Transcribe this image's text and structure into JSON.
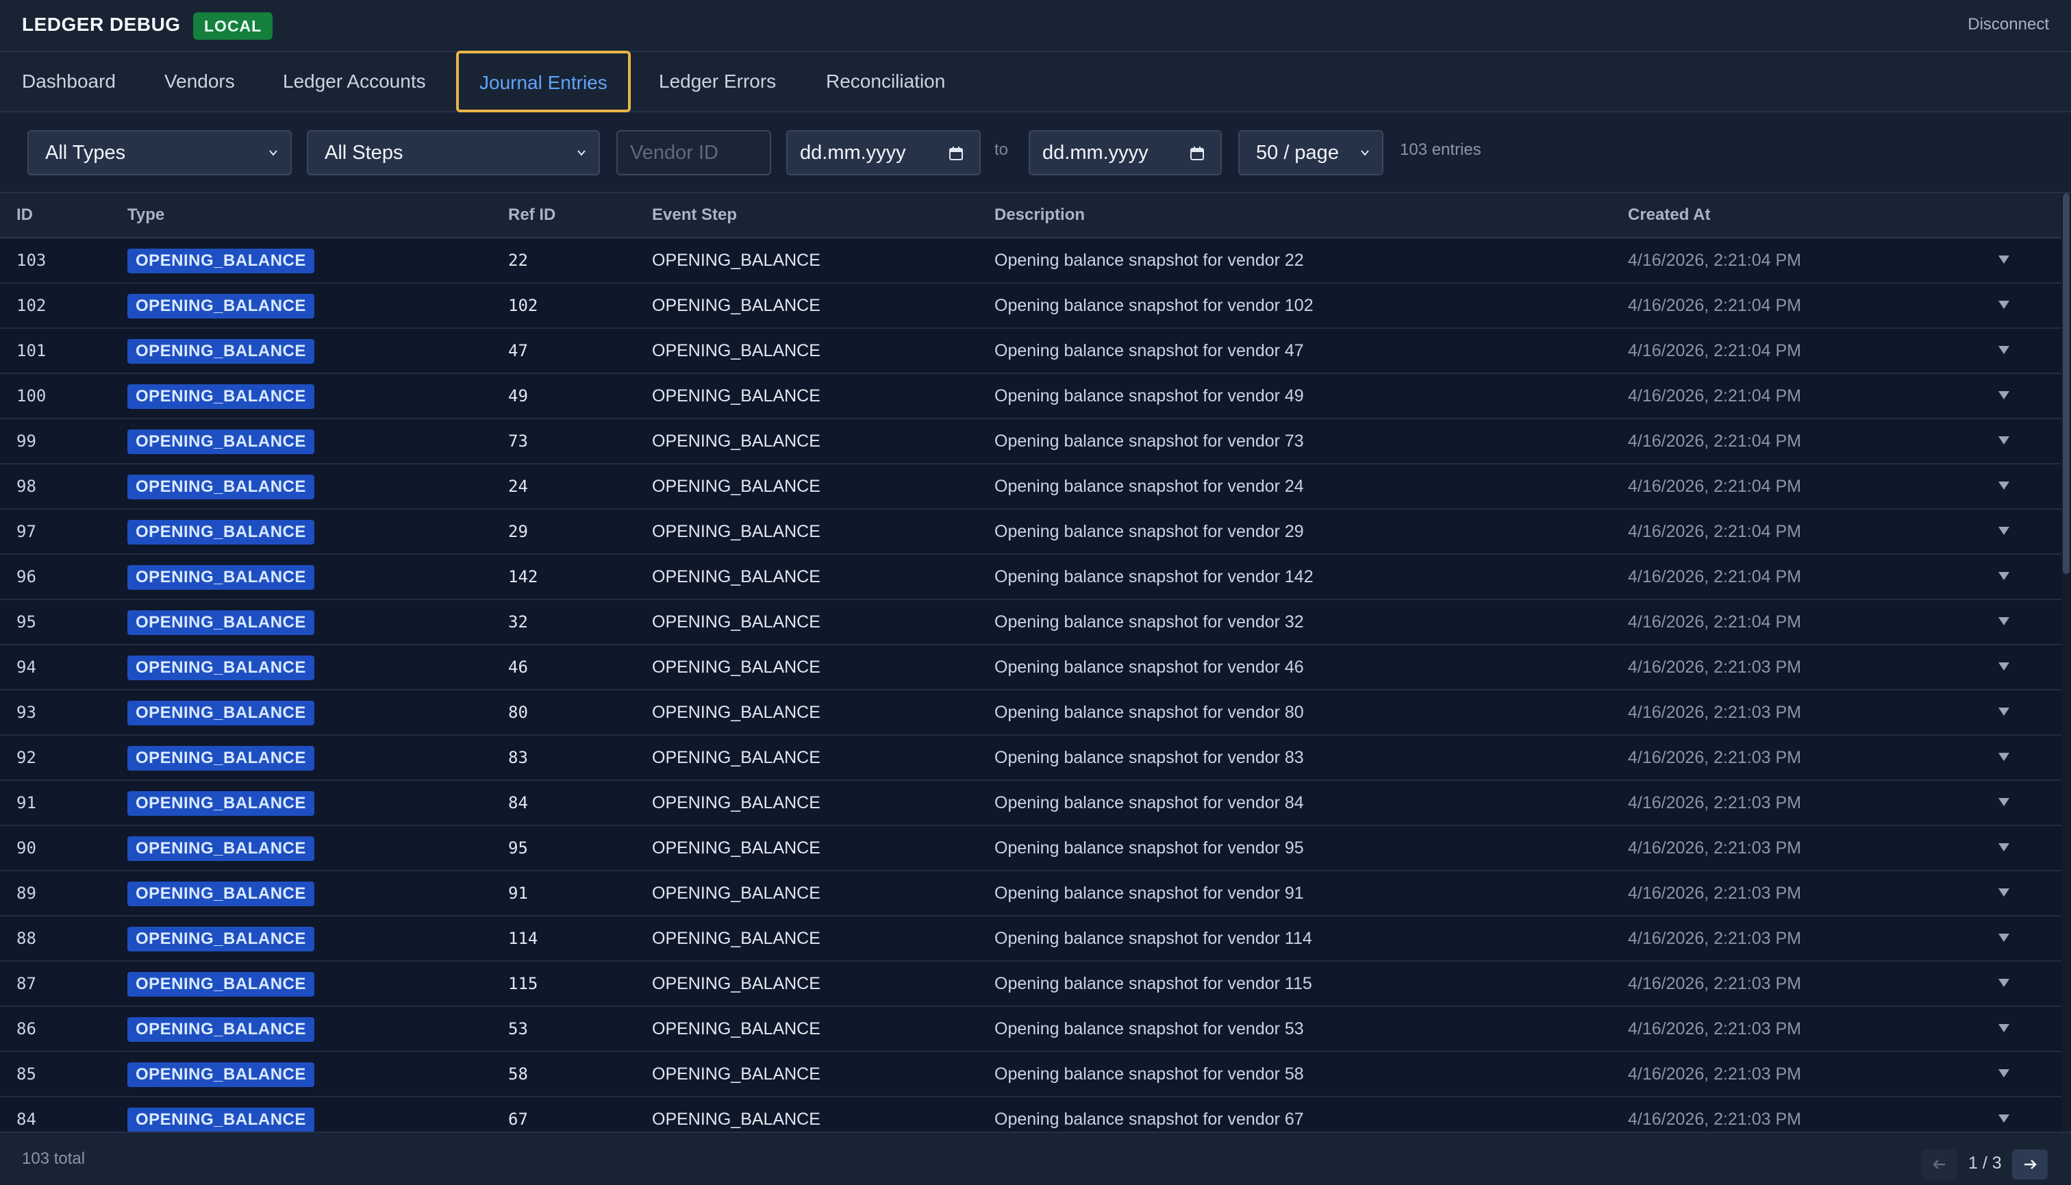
{
  "header": {
    "title": "LEDGER DEBUG",
    "env_badge": "LOCAL",
    "disconnect_label": "Disconnect"
  },
  "tabs": [
    {
      "label": "Dashboard"
    },
    {
      "label": "Vendors"
    },
    {
      "label": "Ledger Accounts"
    },
    {
      "label": "Journal Entries",
      "active": true
    },
    {
      "label": "Ledger Errors"
    },
    {
      "label": "Reconciliation"
    }
  ],
  "filters": {
    "type_select": "All Types",
    "step_select": "All Steps",
    "vendor_placeholder": "Vendor ID",
    "date_from": "dd.mm.yyyy",
    "to_label": "to",
    "date_to": "dd.mm.yyyy",
    "page_size": "50 / page",
    "entries_count": "103 entries"
  },
  "table": {
    "columns": [
      "ID",
      "Type",
      "Ref ID",
      "Event Step",
      "Description",
      "Created At"
    ],
    "rows": [
      {
        "id": "103",
        "type": "OPENING_BALANCE",
        "ref": "22",
        "step": "OPENING_BALANCE",
        "desc": "Opening balance snapshot for vendor 22",
        "created": "4/16/2026, 2:21:04 PM"
      },
      {
        "id": "102",
        "type": "OPENING_BALANCE",
        "ref": "102",
        "step": "OPENING_BALANCE",
        "desc": "Opening balance snapshot for vendor 102",
        "created": "4/16/2026, 2:21:04 PM"
      },
      {
        "id": "101",
        "type": "OPENING_BALANCE",
        "ref": "47",
        "step": "OPENING_BALANCE",
        "desc": "Opening balance snapshot for vendor 47",
        "created": "4/16/2026, 2:21:04 PM"
      },
      {
        "id": "100",
        "type": "OPENING_BALANCE",
        "ref": "49",
        "step": "OPENING_BALANCE",
        "desc": "Opening balance snapshot for vendor 49",
        "created": "4/16/2026, 2:21:04 PM"
      },
      {
        "id": "99",
        "type": "OPENING_BALANCE",
        "ref": "73",
        "step": "OPENING_BALANCE",
        "desc": "Opening balance snapshot for vendor 73",
        "created": "4/16/2026, 2:21:04 PM"
      },
      {
        "id": "98",
        "type": "OPENING_BALANCE",
        "ref": "24",
        "step": "OPENING_BALANCE",
        "desc": "Opening balance snapshot for vendor 24",
        "created": "4/16/2026, 2:21:04 PM"
      },
      {
        "id": "97",
        "type": "OPENING_BALANCE",
        "ref": "29",
        "step": "OPENING_BALANCE",
        "desc": "Opening balance snapshot for vendor 29",
        "created": "4/16/2026, 2:21:04 PM"
      },
      {
        "id": "96",
        "type": "OPENING_BALANCE",
        "ref": "142",
        "step": "OPENING_BALANCE",
        "desc": "Opening balance snapshot for vendor 142",
        "created": "4/16/2026, 2:21:04 PM"
      },
      {
        "id": "95",
        "type": "OPENING_BALANCE",
        "ref": "32",
        "step": "OPENING_BALANCE",
        "desc": "Opening balance snapshot for vendor 32",
        "created": "4/16/2026, 2:21:04 PM"
      },
      {
        "id": "94",
        "type": "OPENING_BALANCE",
        "ref": "46",
        "step": "OPENING_BALANCE",
        "desc": "Opening balance snapshot for vendor 46",
        "created": "4/16/2026, 2:21:03 PM"
      },
      {
        "id": "93",
        "type": "OPENING_BALANCE",
        "ref": "80",
        "step": "OPENING_BALANCE",
        "desc": "Opening balance snapshot for vendor 80",
        "created": "4/16/2026, 2:21:03 PM"
      },
      {
        "id": "92",
        "type": "OPENING_BALANCE",
        "ref": "83",
        "step": "OPENING_BALANCE",
        "desc": "Opening balance snapshot for vendor 83",
        "created": "4/16/2026, 2:21:03 PM"
      },
      {
        "id": "91",
        "type": "OPENING_BALANCE",
        "ref": "84",
        "step": "OPENING_BALANCE",
        "desc": "Opening balance snapshot for vendor 84",
        "created": "4/16/2026, 2:21:03 PM"
      },
      {
        "id": "90",
        "type": "OPENING_BALANCE",
        "ref": "95",
        "step": "OPENING_BALANCE",
        "desc": "Opening balance snapshot for vendor 95",
        "created": "4/16/2026, 2:21:03 PM"
      },
      {
        "id": "89",
        "type": "OPENING_BALANCE",
        "ref": "91",
        "step": "OPENING_BALANCE",
        "desc": "Opening balance snapshot for vendor 91",
        "created": "4/16/2026, 2:21:03 PM"
      },
      {
        "id": "88",
        "type": "OPENING_BALANCE",
        "ref": "114",
        "step": "OPENING_BALANCE",
        "desc": "Opening balance snapshot for vendor 114",
        "created": "4/16/2026, 2:21:03 PM"
      },
      {
        "id": "87",
        "type": "OPENING_BALANCE",
        "ref": "115",
        "step": "OPENING_BALANCE",
        "desc": "Opening balance snapshot for vendor 115",
        "created": "4/16/2026, 2:21:03 PM"
      },
      {
        "id": "86",
        "type": "OPENING_BALANCE",
        "ref": "53",
        "step": "OPENING_BALANCE",
        "desc": "Opening balance snapshot for vendor 53",
        "created": "4/16/2026, 2:21:03 PM"
      },
      {
        "id": "85",
        "type": "OPENING_BALANCE",
        "ref": "58",
        "step": "OPENING_BALANCE",
        "desc": "Opening balance snapshot for vendor 58",
        "created": "4/16/2026, 2:21:03 PM"
      },
      {
        "id": "84",
        "type": "OPENING_BALANCE",
        "ref": "67",
        "step": "OPENING_BALANCE",
        "desc": "Opening balance snapshot for vendor 67",
        "created": "4/16/2026, 2:21:03 PM"
      }
    ]
  },
  "footer": {
    "total": "103 total",
    "page_indicator": "1 / 3"
  },
  "icons": {
    "select_caret": "chevron-down-icon",
    "date_picker": "calendar-icon",
    "row_expand": "triangle-down-icon",
    "prev": "arrow-left-icon",
    "next": "arrow-right-icon"
  },
  "colors": {
    "background": "#0f172a",
    "accent": "#60a5fa",
    "active_tab_border": "#e8b44a",
    "type_badge": "#1e4fc2",
    "env_badge": "#15803d"
  }
}
